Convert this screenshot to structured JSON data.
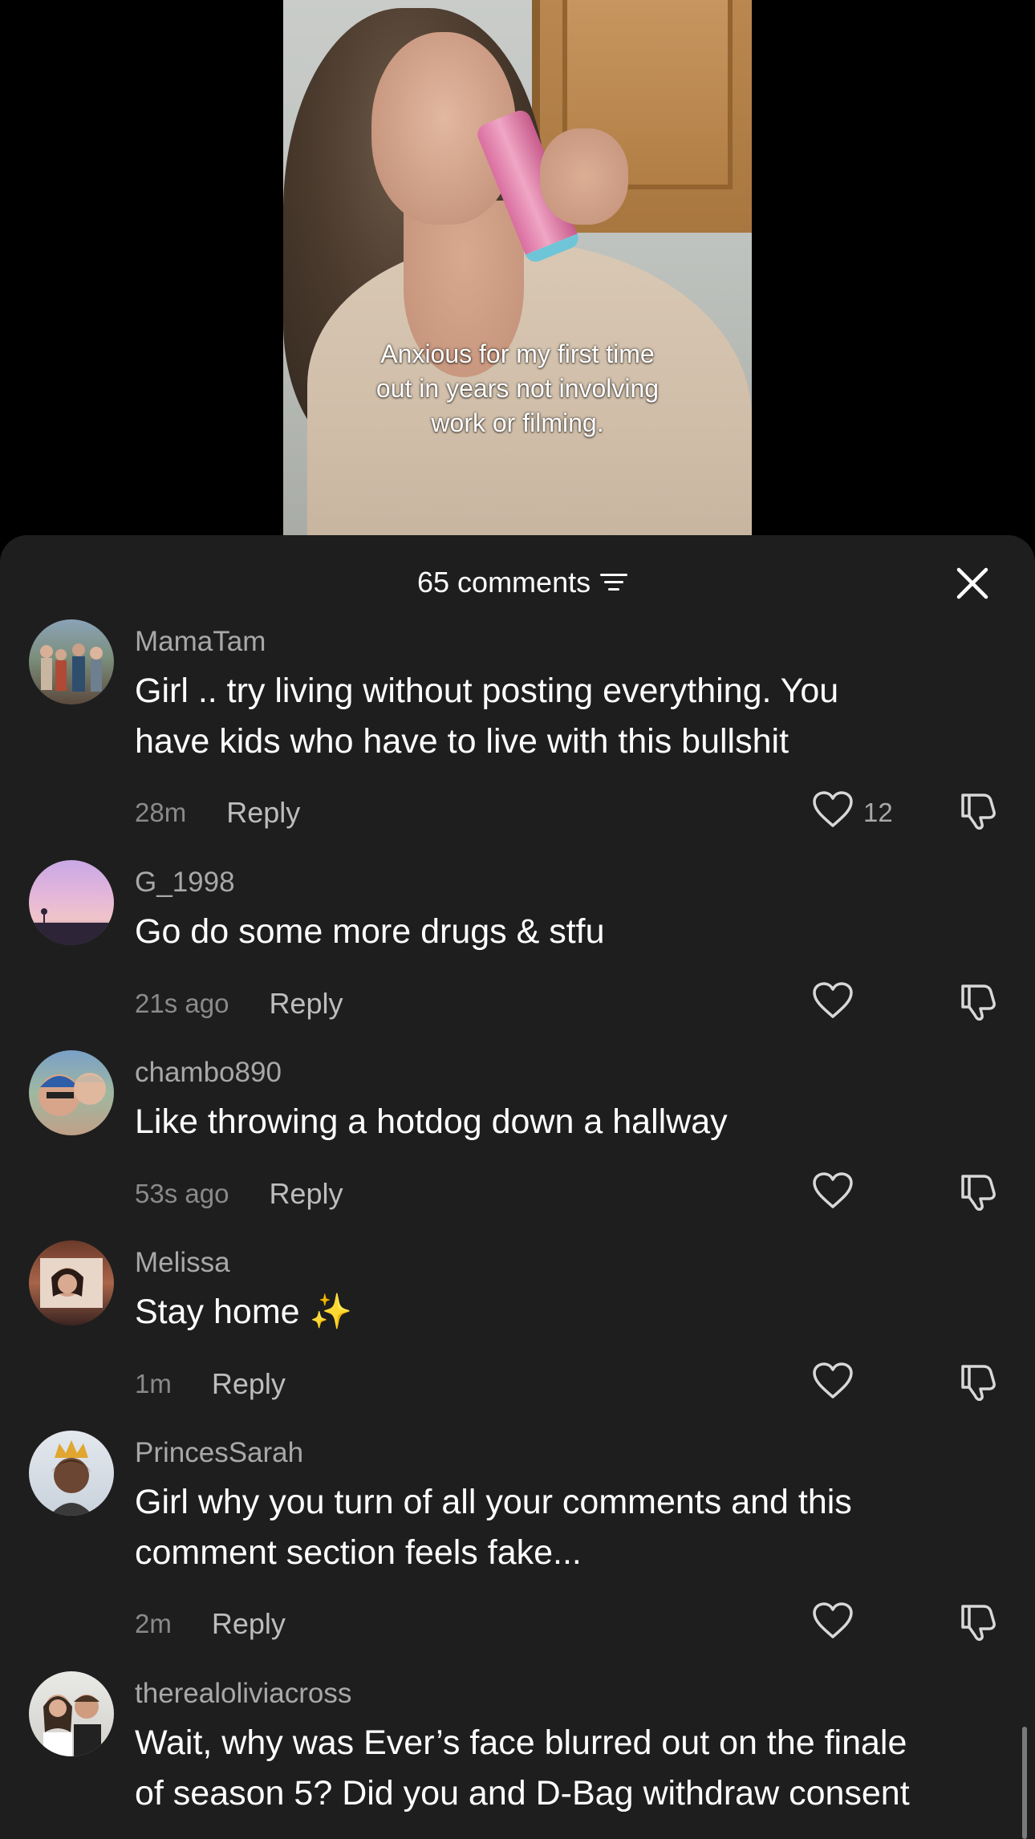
{
  "video": {
    "caption_lines": [
      "Anxious for my first time",
      "out in years not involving",
      "work or filming."
    ]
  },
  "header": {
    "comment_count_label": "65 comments",
    "filter_icon": "sort-filter-icon",
    "close_icon": "close-icon"
  },
  "colors": {
    "sheet_background": "#1e1e1e",
    "username": "#a8a8a8",
    "comment_text": "#ffffff",
    "timestamp": "#8a8a8a"
  },
  "comments": [
    {
      "username": "MamaTam",
      "lines": [
        "Girl .. try living without posting everything. You",
        "have kids who have to live with this bullshit"
      ],
      "time": "28m",
      "reply_label": "Reply",
      "likes": "12"
    },
    {
      "username": "G_1998",
      "lines": [
        "Go do some more drugs & stfu"
      ],
      "time": "21s ago",
      "reply_label": "Reply",
      "likes": ""
    },
    {
      "username": "chambo890",
      "lines": [
        "Like throwing a hotdog down a hallway"
      ],
      "time": "53s ago",
      "reply_label": "Reply",
      "likes": ""
    },
    {
      "username": "Melissa",
      "lines": [
        "Stay home ✨"
      ],
      "time": "1m",
      "reply_label": "Reply",
      "likes": ""
    },
    {
      "username": "PrincesSarah",
      "lines": [
        "Girl why you turn of all your comments and this",
        "comment section feels fake..."
      ],
      "time": "2m",
      "reply_label": "Reply",
      "likes": ""
    },
    {
      "username": "therealoliviacross",
      "lines": [
        "Wait, why was Ever’s face blurred out on the finale",
        "of season 5? Did you and D-Bag withdraw consent"
      ],
      "time": "",
      "reply_label": "",
      "likes": ""
    }
  ]
}
